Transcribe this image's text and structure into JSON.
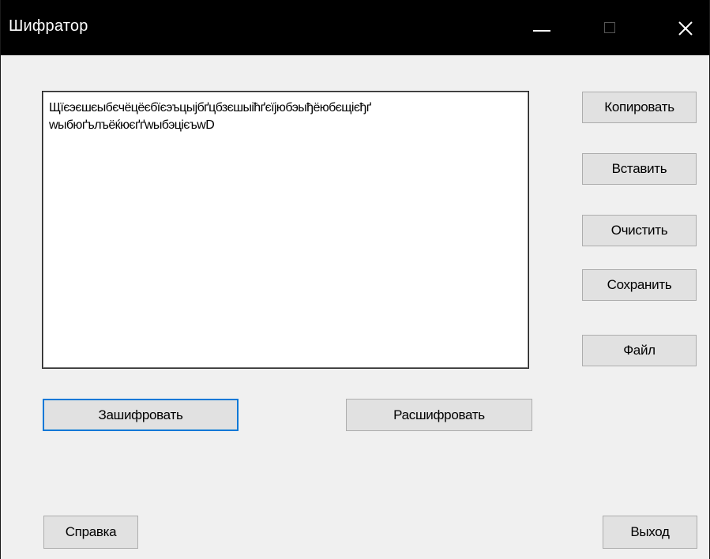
{
  "window": {
    "title": "Шифратор"
  },
  "editor": {
    "value": "Щїєэєшєыбєчёцёєбїєэъцыјбґцбзєшыіћґєїјюбэыђёюбєщієђґ\nwыбюґълъёќюєґґwыбэцієъwD"
  },
  "buttons": {
    "copy": "Копировать",
    "paste": "Вставить",
    "clear": "Очистить",
    "save": "Сохранить",
    "file": "Файл",
    "encrypt": "Зашифровать",
    "decrypt": "Расшифровать",
    "help": "Справка",
    "exit": "Выход"
  },
  "colors": {
    "titlebar": "#000000",
    "window_bg": "#f0f0f0",
    "button_bg": "#e1e1e1",
    "focus_border": "#0078d7"
  }
}
